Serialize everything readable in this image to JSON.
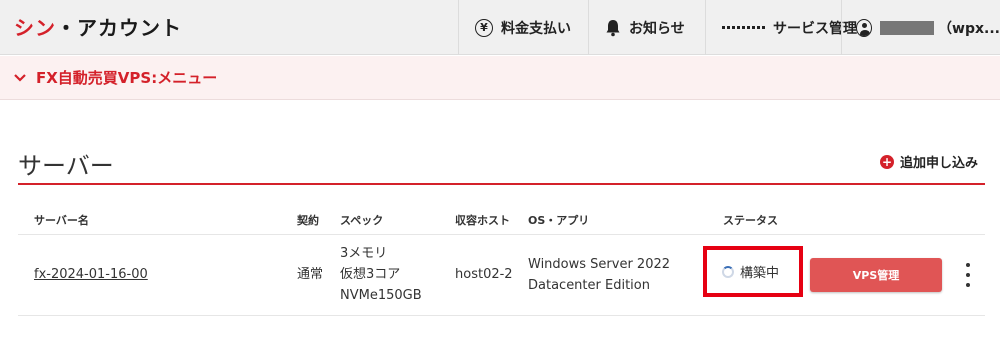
{
  "header": {
    "logo_main": "シン",
    "logo_rest": "・アカウント",
    "nav": {
      "pay": {
        "icon": "yen-icon",
        "icon_glyph": "¥",
        "label": "料金支払い"
      },
      "notice": {
        "icon": "bell-icon",
        "label": "お知らせ"
      },
      "service": {
        "icon": "grid-icon",
        "label": "サービス管理"
      },
      "account": {
        "icon": "user-icon",
        "label_suffix": "（wpx..."
      }
    }
  },
  "subheader": {
    "chevron": "⌄",
    "title": "FX自動売買VPS:メニュー"
  },
  "section": {
    "title": "サーバー",
    "add_label": "追加申し込み",
    "add_icon": "+"
  },
  "table": {
    "headers": [
      "サーバー名",
      "契約",
      "スペック",
      "収容ホスト",
      "OS・アプリ",
      "ステータス"
    ],
    "rows": [
      {
        "server_name": "fx-2024-01-16-00",
        "contract": "通常",
        "spec": [
          "3メモリ",
          "仮想3コア",
          "NVMe150GB"
        ],
        "host": "host02-2",
        "os": [
          "Windows Server 2022",
          "Datacenter Edition"
        ],
        "status": "構築中",
        "action": "VPS管理"
      }
    ]
  },
  "colors": {
    "accent": "#d4212a",
    "highlight_box": "#e60012",
    "button": "#e05555"
  }
}
